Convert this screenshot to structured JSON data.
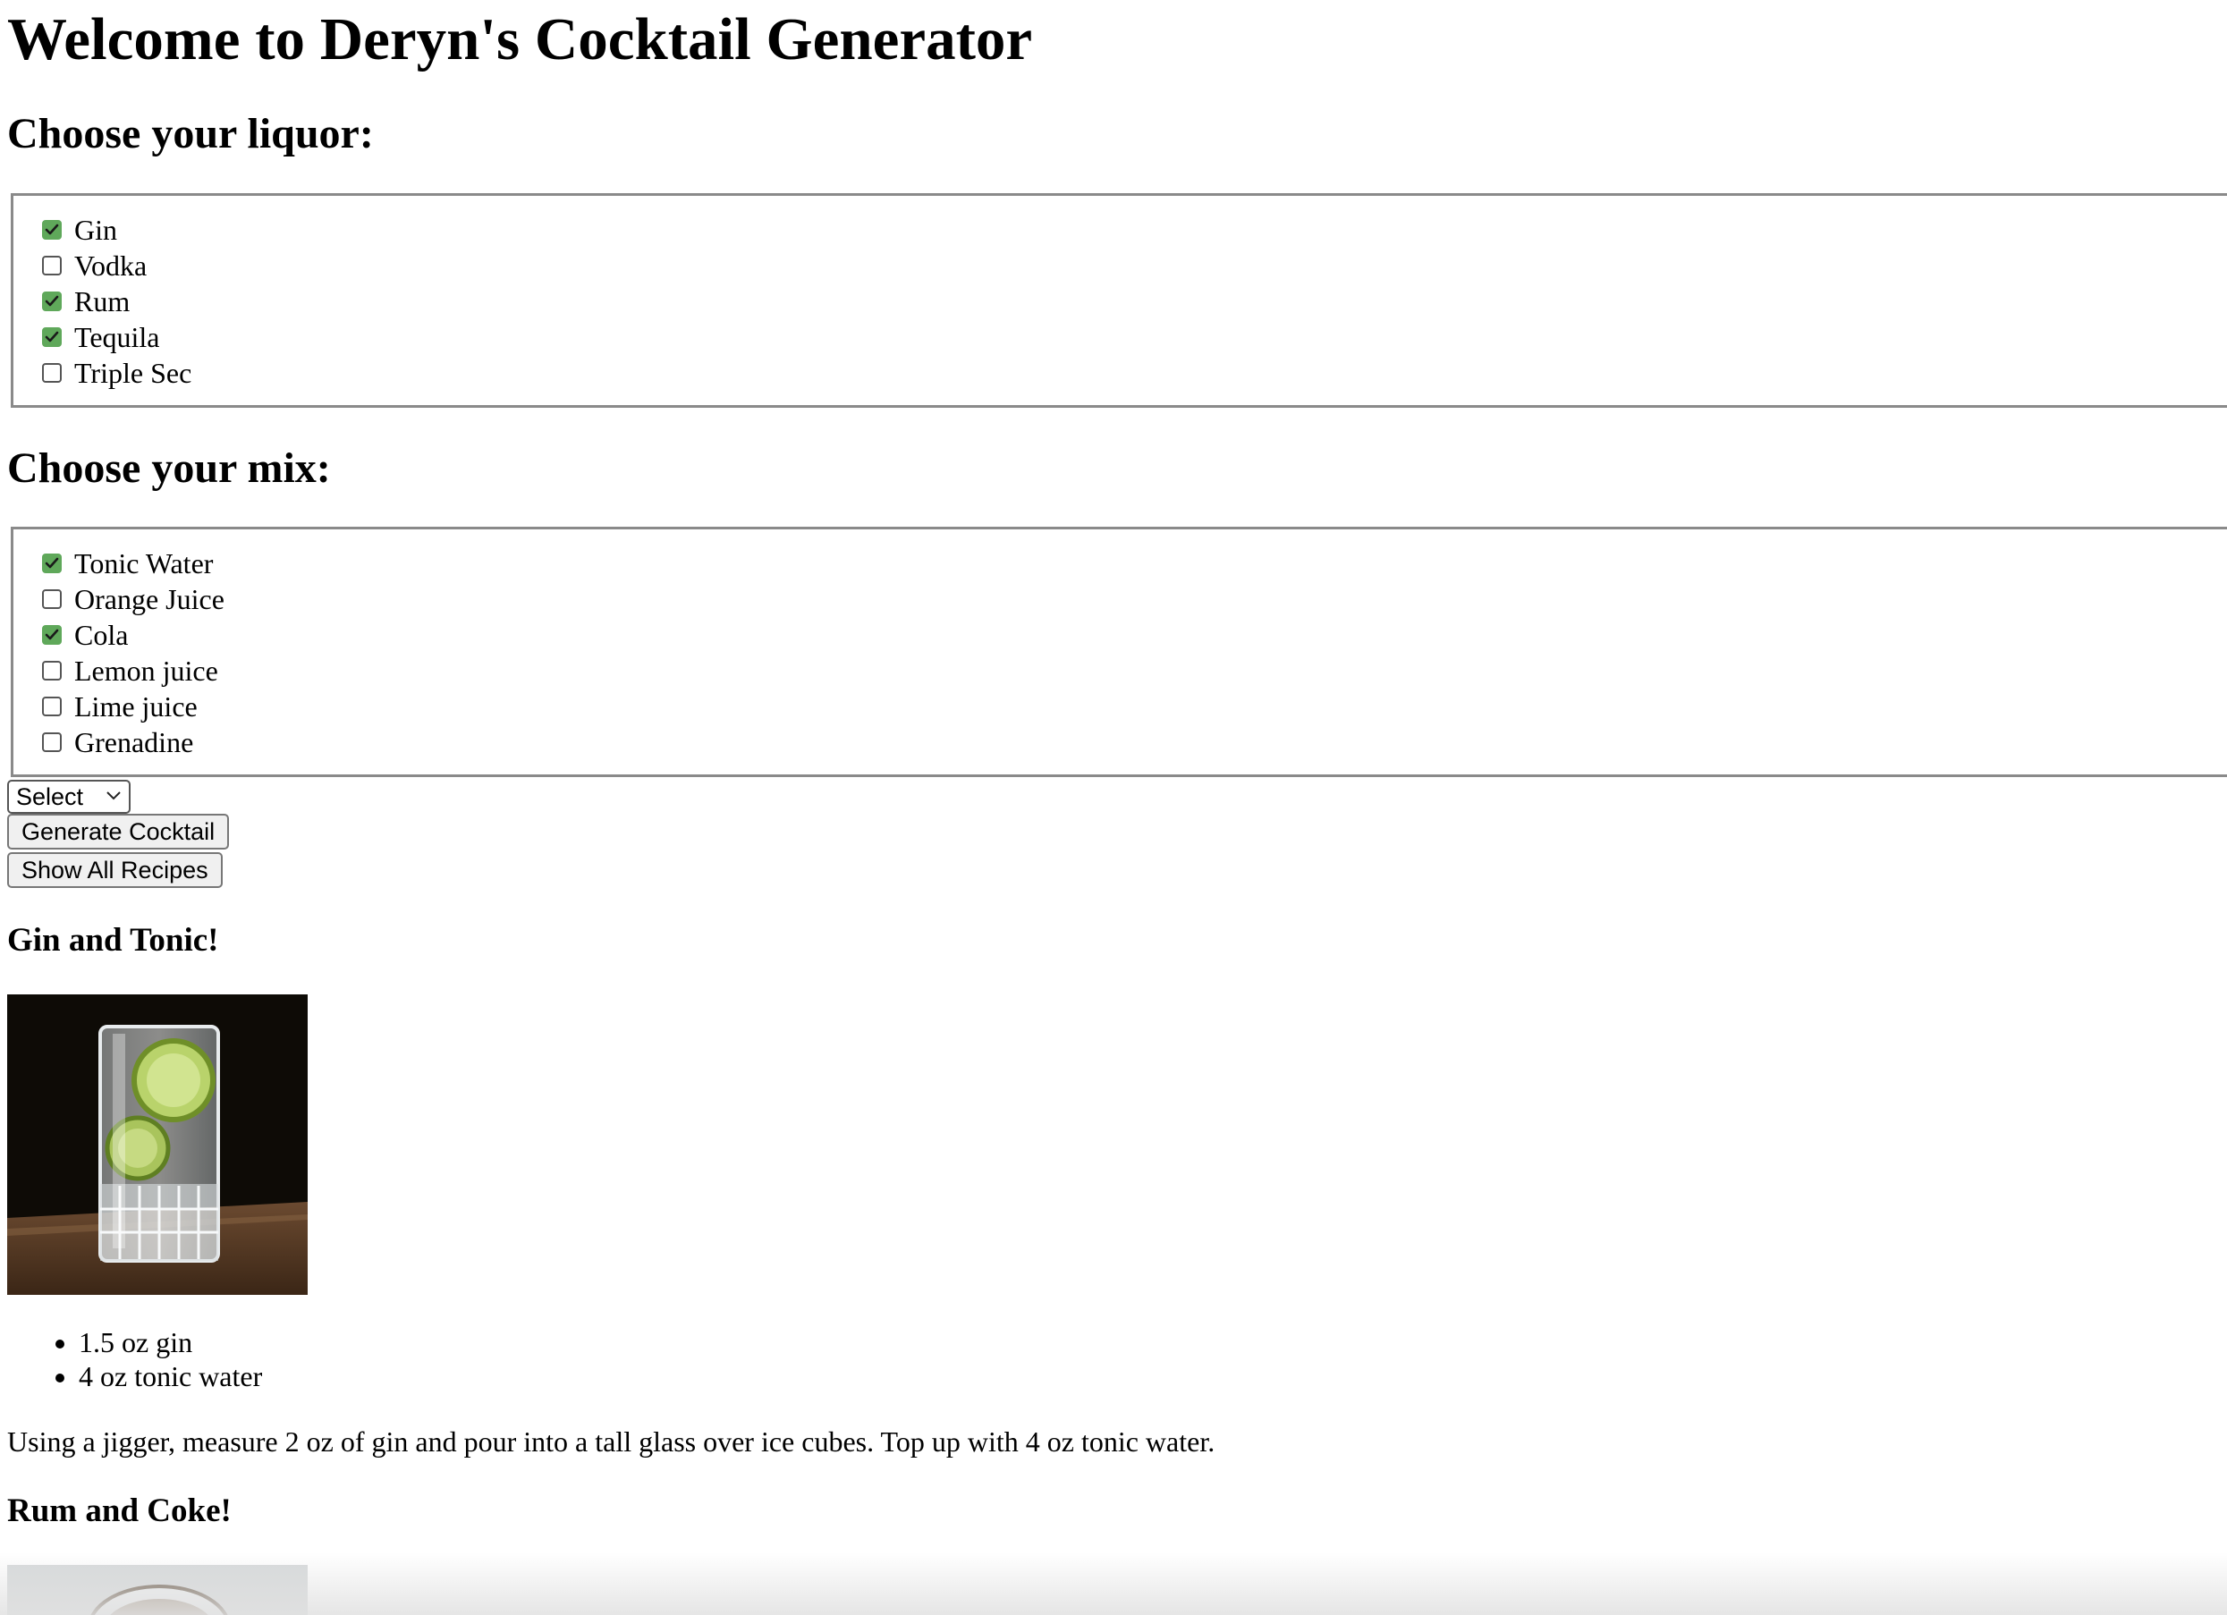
{
  "page": {
    "title": "Welcome to Deryn's Cocktail Generator"
  },
  "liquor": {
    "heading": "Choose your liquor:",
    "options": [
      {
        "label": "Gin",
        "checked": true
      },
      {
        "label": "Vodka",
        "checked": false
      },
      {
        "label": "Rum",
        "checked": true
      },
      {
        "label": "Tequila",
        "checked": true
      },
      {
        "label": "Triple Sec",
        "checked": false
      }
    ]
  },
  "mix": {
    "heading": "Choose your mix:",
    "options": [
      {
        "label": "Tonic Water",
        "checked": true
      },
      {
        "label": "Orange Juice",
        "checked": false
      },
      {
        "label": "Cola",
        "checked": true
      },
      {
        "label": "Lemon juice",
        "checked": false
      },
      {
        "label": "Lime juice",
        "checked": false
      },
      {
        "label": "Grenadine",
        "checked": false
      }
    ]
  },
  "controls": {
    "select_value": "Select",
    "generate_label": "Generate Cocktail",
    "show_all_label": "Show All Recipes"
  },
  "recipes": [
    {
      "title": "Gin and Tonic!",
      "ingredients": [
        "1.5 oz gin",
        "4 oz tonic water"
      ],
      "instructions": "Using a jigger, measure 2 oz of gin and pour into a tall glass over ice cubes. Top up with 4 oz tonic water."
    },
    {
      "title": "Rum and Coke!"
    }
  ],
  "colors": {
    "checkbox_checked": "#5fa85a",
    "fieldset_border": "#8a8a8a",
    "button_bg": "#f0f0f0"
  }
}
